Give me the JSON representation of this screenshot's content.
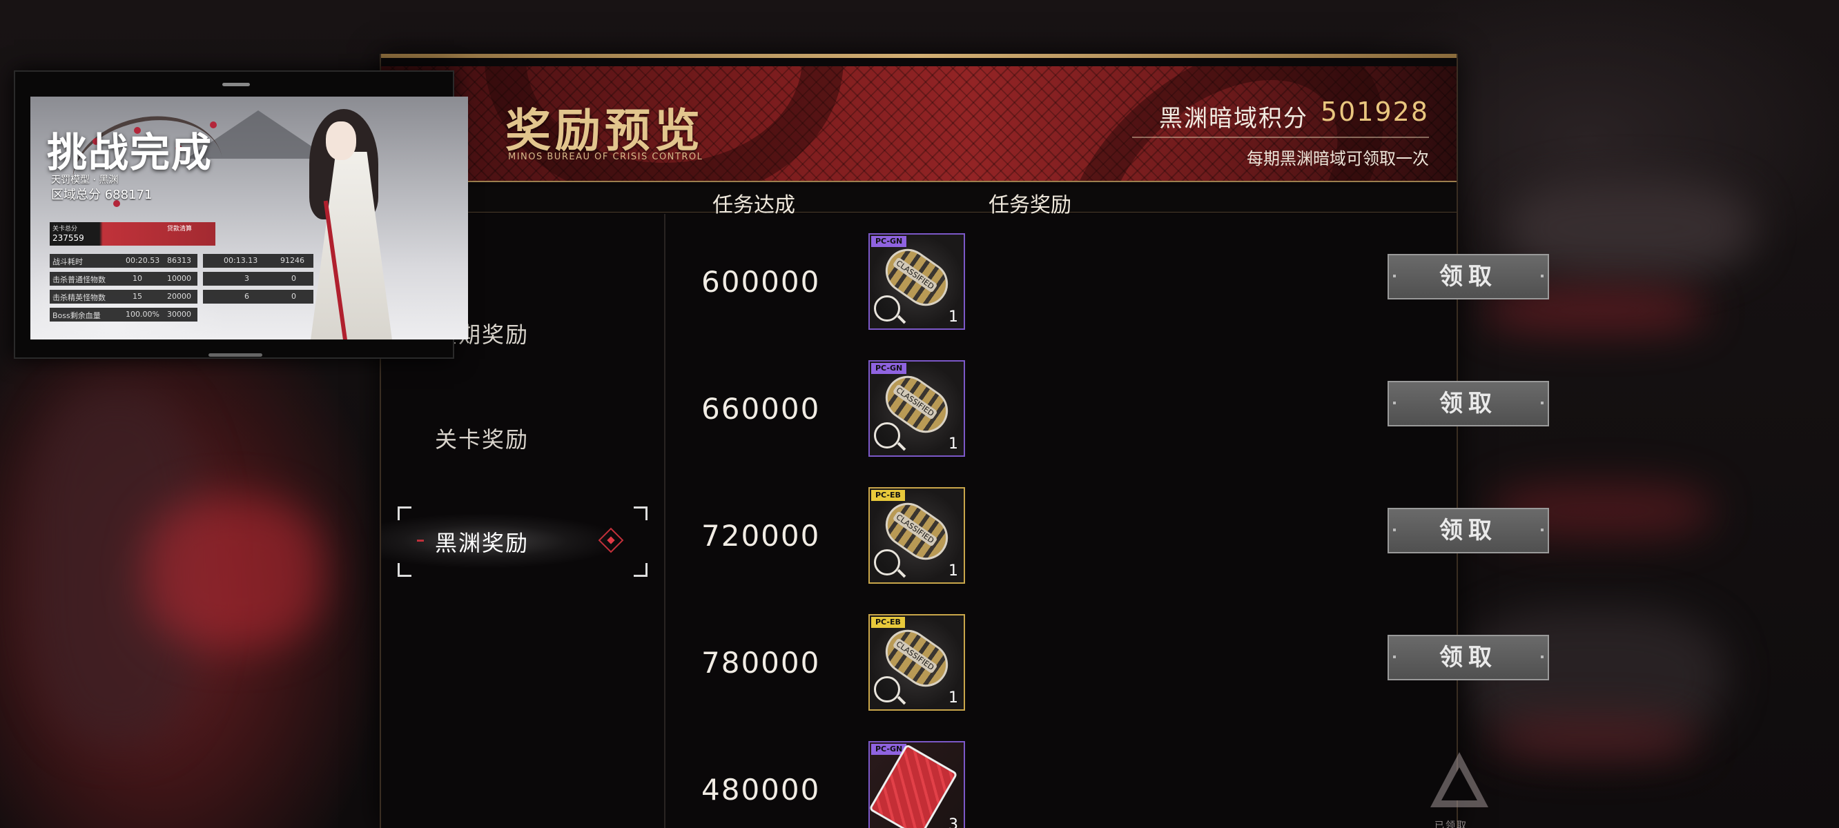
{
  "header": {
    "title": "奖励预览",
    "subtitle": "MINOS BUREAU OF CRISIS CONTROL",
    "score_label": "黑渊暗域积分",
    "score_value": "501928",
    "score_note": "每期黑渊暗域可领取一次"
  },
  "columns": {
    "task": "任务达成",
    "reward": "任务奖励"
  },
  "sidebar": {
    "items": [
      {
        "label": "星期奖励"
      },
      {
        "label": "关卡奖励"
      },
      {
        "label": "黑渊奖励"
      }
    ],
    "active_index": 2
  },
  "rows": [
    {
      "goal": "600000",
      "tag": "PC-GN",
      "count": "1",
      "button": "领取"
    },
    {
      "goal": "660000",
      "tag": "PC-GN",
      "count": "1",
      "button": "领取"
    },
    {
      "goal": "720000",
      "tag": "PC-EB",
      "count": "1",
      "button": "领取"
    },
    {
      "goal": "780000",
      "tag": "PC-EB",
      "count": "1",
      "button": "领取"
    },
    {
      "goal": "480000",
      "tag": "PC-GN",
      "count": "3",
      "status": "已领取"
    }
  ],
  "popup": {
    "title": "挑战完成",
    "subtitle": "天罚模型 · 黑渊",
    "total_label": "区域总分",
    "total_value": "688171",
    "bar_label": "关卡总分",
    "bar_value": "237559",
    "bar_tag": "贷款清算",
    "stats_left": [
      {
        "label": "战斗耗时",
        "v1": "00:20.53",
        "v2": "86313"
      },
      {
        "label": "击杀普通怪物数",
        "v1": "10",
        "v2": "10000"
      },
      {
        "label": "击杀精英怪物数",
        "v1": "15",
        "v2": "20000"
      },
      {
        "label": "Boss剩余血量",
        "v1": "100.00%",
        "v2": "30000"
      }
    ],
    "stats_right": [
      {
        "v1": "00:13.13",
        "v2": "91246"
      },
      {
        "v1": "3",
        "v2": "0"
      },
      {
        "v1": "6",
        "v2": "0"
      }
    ]
  },
  "colors": {
    "accent_gold": "#e9c77f",
    "accent_red": "#c0303a",
    "item_purple": "#7c58c8",
    "item_gold": "#c9a64a"
  }
}
